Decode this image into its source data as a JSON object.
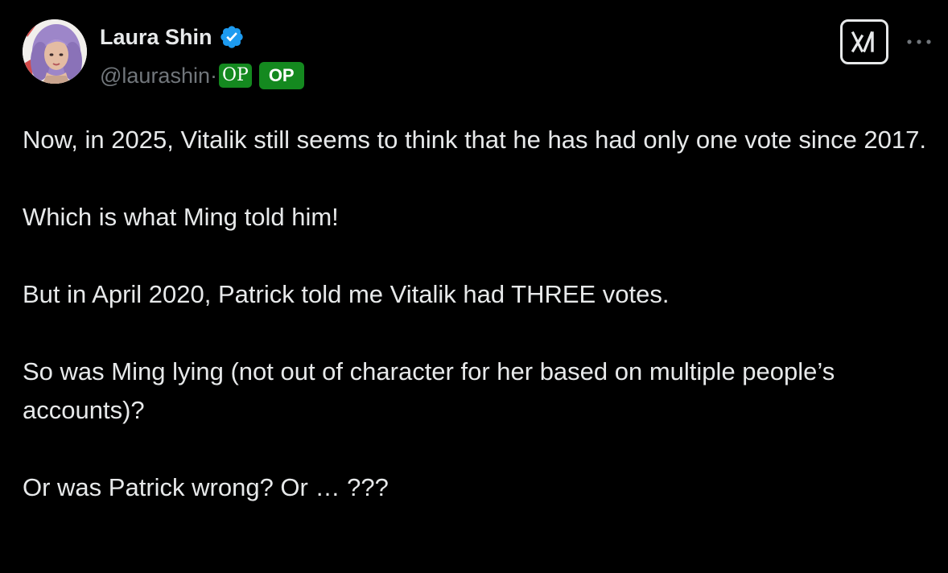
{
  "author": {
    "display_name": "Laura Shin",
    "handle": "@laurashin·",
    "verified_icon": "verified-badge-icon",
    "verified_color": "#1d9bf0",
    "badges": [
      "OP",
      "OP"
    ],
    "badge_color": "#14891f"
  },
  "toolbar": {
    "grok_icon": "xai-grok-icon",
    "more_icon": "more-dots-icon"
  },
  "post": {
    "paragraphs": [
      "Now, in 2025, Vitalik still seems to think that he has had only one vote since 2017.",
      "Which is what Ming told him!",
      "But in April 2020, Patrick told me Vitalik had THREE votes.",
      "So was Ming lying (not out of character for her based on multiple people’s accounts)?",
      "Or was Patrick wrong? Or … ???"
    ]
  },
  "colors": {
    "background": "#000000",
    "text_primary": "#e7e9ea",
    "text_secondary": "#71767b"
  }
}
